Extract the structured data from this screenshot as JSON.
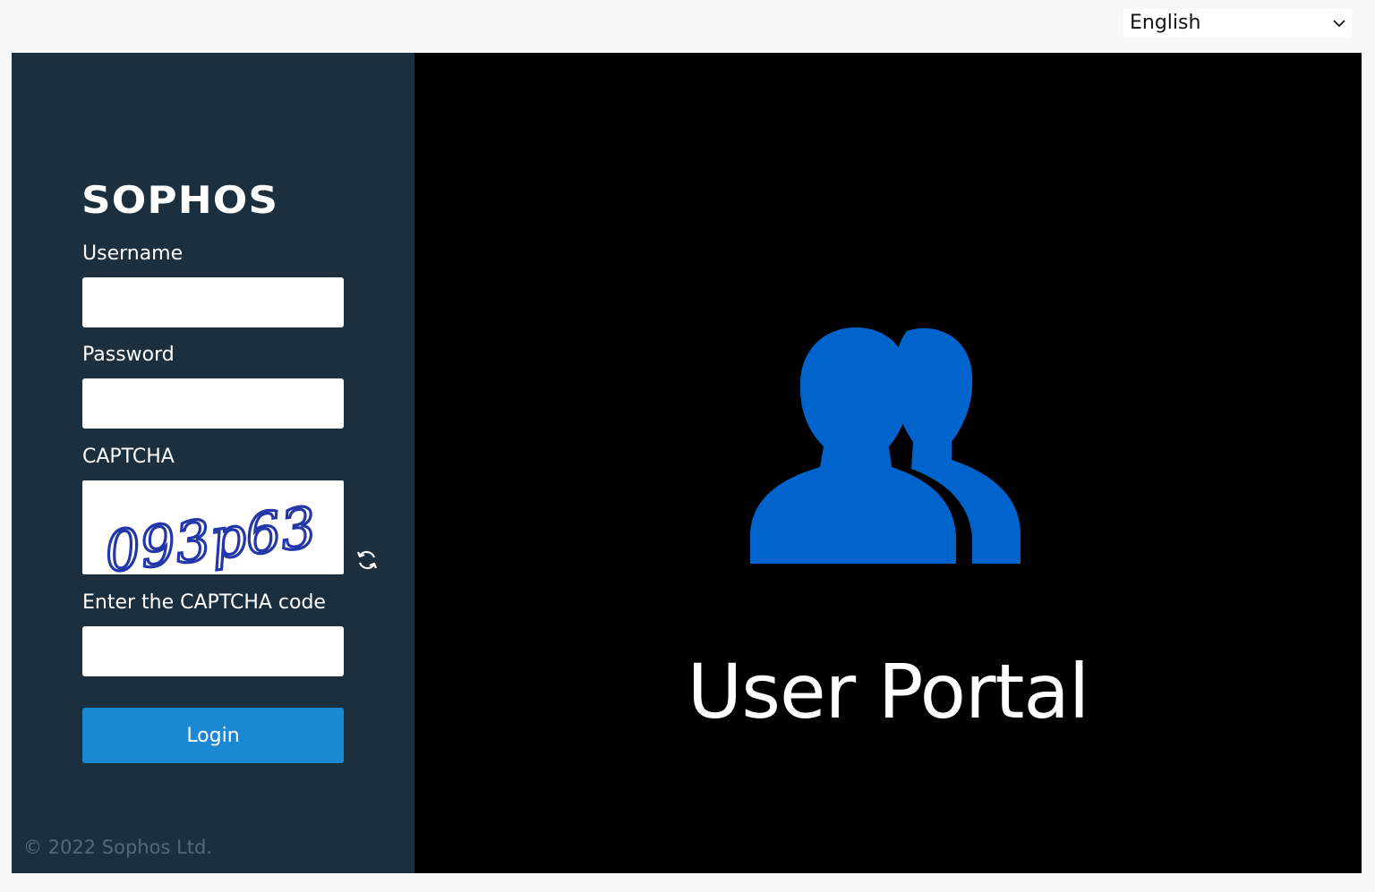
{
  "language": {
    "selected": "English"
  },
  "brand": {
    "logo_text": "SOPHOS"
  },
  "form": {
    "username_label": "Username",
    "username_value": "",
    "password_label": "Password",
    "password_value": "",
    "captcha_label": "CAPTCHA",
    "captcha_image_text": "093p63",
    "captcha_code_label": "Enter the CAPTCHA code",
    "captcha_code_value": "",
    "login_label": "Login"
  },
  "footer": {
    "copyright": "© 2022 Sophos Ltd."
  },
  "hero": {
    "title": "User Portal"
  },
  "colors": {
    "panel_bg": "#1b2f3f",
    "accent_blue": "#1b88d3",
    "icon_blue": "#0064cc"
  }
}
